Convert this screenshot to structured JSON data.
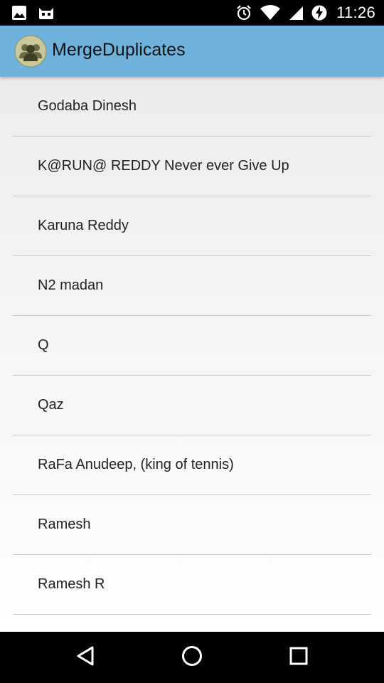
{
  "status_bar": {
    "time": "11:26",
    "left_icons": [
      "image-icon",
      "cyanogen-icon"
    ],
    "right_icons": [
      "alarm-icon",
      "wifi-icon",
      "signal-icon",
      "battery-charging-icon"
    ]
  },
  "app_bar": {
    "title": "MergeDuplicates",
    "color": "#6fb3dc"
  },
  "contacts": [
    {
      "name": "Godaba Dinesh"
    },
    {
      "name": "K@RUN@ REDDY Never ever Give Up"
    },
    {
      "name": "Karuna Reddy"
    },
    {
      "name": "N2 madan"
    },
    {
      "name": "Q"
    },
    {
      "name": "Qaz"
    },
    {
      "name": "RaFa Anudeep, (king of tennis)"
    },
    {
      "name": "Ramesh"
    },
    {
      "name": "Ramesh R"
    }
  ],
  "nav_bar": {
    "icons": [
      "back-icon",
      "home-icon",
      "recents-icon"
    ]
  }
}
